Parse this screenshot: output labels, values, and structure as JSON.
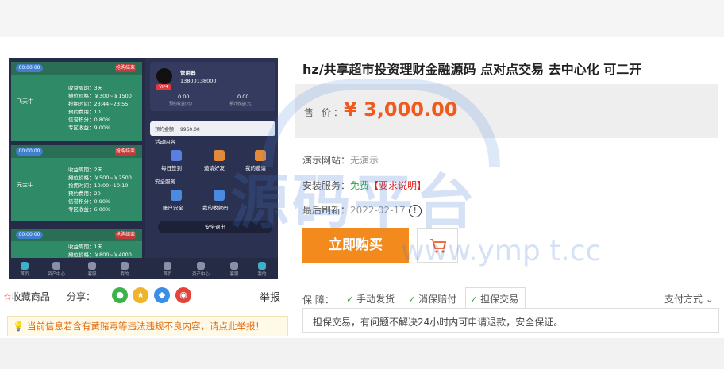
{
  "product_image": {
    "cards": [
      {
        "timer": "00:00:00",
        "tag": "抢购结束",
        "name": "飞天牛",
        "rows": [
          "收益周期：3天",
          "摊位价格：￥300~￥1500",
          "抢拥时间：23:44~23:55",
          "预约费用：10",
          "信誉积分：0.80%",
          "专区收益：9.00%"
        ]
      },
      {
        "timer": "00:00:00",
        "tag": "抢购结束",
        "name": "元宝牛",
        "rows": [
          "收益周期：2天",
          "摊位价格：￥500~￥2500",
          "抢拥时间：10:00~10:10",
          "预约费用：20",
          "信誉积分：0.90%",
          "专区收益：6.00%"
        ]
      },
      {
        "timer": "00:00:00",
        "tag": "抢购结束",
        "name": "",
        "rows": [
          "收益周期：1天",
          "摊位价格：￥800~￥4000"
        ]
      }
    ],
    "user": {
      "name": "管用器",
      "phone": "13800138000",
      "vip": "VIP4",
      "stat1_val": "0.00",
      "stat1_label": "预约收益(元)",
      "stat2_val": "0.00",
      "stat2_label": "累计收益(元)",
      "balance": "预约金额：",
      "balance_val": "9960.00"
    },
    "activity_title": "活动内容",
    "activity_items": [
      "每日签到",
      "邀请好友",
      "我的邀请"
    ],
    "safety_title": "安全服务",
    "safety_items": [
      "账户安全",
      "我的收款码"
    ],
    "logout": "安全退出",
    "tabs": [
      "首页",
      "资产中心",
      "客服",
      "我的",
      "首页",
      "资产中心",
      "客服",
      "我的"
    ]
  },
  "title": "hz/共享超市投资理财金融源码 点对点交易 去中心化 可二开",
  "price_label": "售 价：",
  "price": "¥ 3,000.00",
  "demo_label": "演示网站：",
  "demo_value": "无演示",
  "install_label": "安装服务：",
  "install_free": "免费",
  "install_req": "【要求说明】",
  "refresh_label": "最后刷新：",
  "refresh_value": "2022-02-17",
  "buy_label": "立即购买",
  "watermark": "源码平台",
  "watermark_url": "www.ymp t.cc",
  "favorite_label": "收藏商品",
  "share_label": "分享：",
  "report_label": "举报",
  "notice": "当前信息若含有黄赌毒等违法违规不良内容，请点此举报！",
  "guarantee_label": "保 障：",
  "guarantee_items": [
    "手动发货",
    "消保赔付",
    "担保交易"
  ],
  "pay_label": "支付方式",
  "guarantee_desc": "担保交易，有问题不解决24小时内可申请退款，安全保证。"
}
